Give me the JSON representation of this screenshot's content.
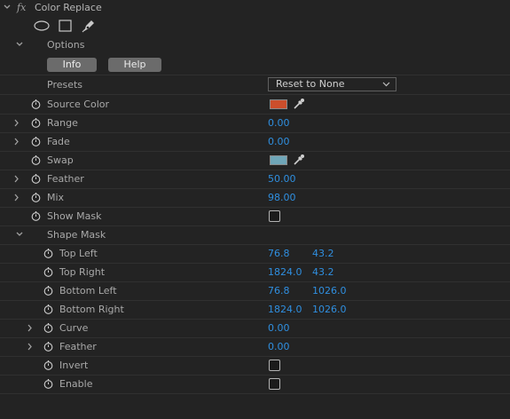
{
  "effect": {
    "fx_label": "fx",
    "name": "Color Replace"
  },
  "tools": [
    "ellipse-mask-icon",
    "rectangle-mask-icon",
    "pen-mask-icon"
  ],
  "options": {
    "label": "Options",
    "info_label": "Info",
    "help_label": "Help"
  },
  "presets": {
    "label": "Presets",
    "selected": "Reset to None"
  },
  "colors": {
    "source": "#cc4e2c",
    "swap": "#6fa6b8",
    "value": "#2f8fe0",
    "background": "#232323"
  },
  "props": {
    "source_color": {
      "label": "Source Color"
    },
    "range": {
      "label": "Range",
      "value": "0.00"
    },
    "fade": {
      "label": "Fade",
      "value": "0.00"
    },
    "swap": {
      "label": "Swap"
    },
    "feather": {
      "label": "Feather",
      "value": "50.00"
    },
    "mix": {
      "label": "Mix",
      "value": "98.00"
    },
    "show_mask": {
      "label": "Show Mask",
      "checked": false
    }
  },
  "shape_mask": {
    "label": "Shape Mask",
    "top_left": {
      "label": "Top Left",
      "x": "76.8",
      "y": "43.2"
    },
    "top_right": {
      "label": "Top Right",
      "x": "1824.0",
      "y": "43.2"
    },
    "bottom_left": {
      "label": "Bottom Left",
      "x": "76.8",
      "y": "1026.0"
    },
    "bottom_right": {
      "label": "Bottom Right",
      "x": "1824.0",
      "y": "1026.0"
    },
    "curve": {
      "label": "Curve",
      "value": "0.00"
    },
    "feather": {
      "label": "Feather",
      "value": "0.00"
    },
    "invert": {
      "label": "Invert",
      "checked": false
    },
    "enable": {
      "label": "Enable",
      "checked": false
    }
  }
}
